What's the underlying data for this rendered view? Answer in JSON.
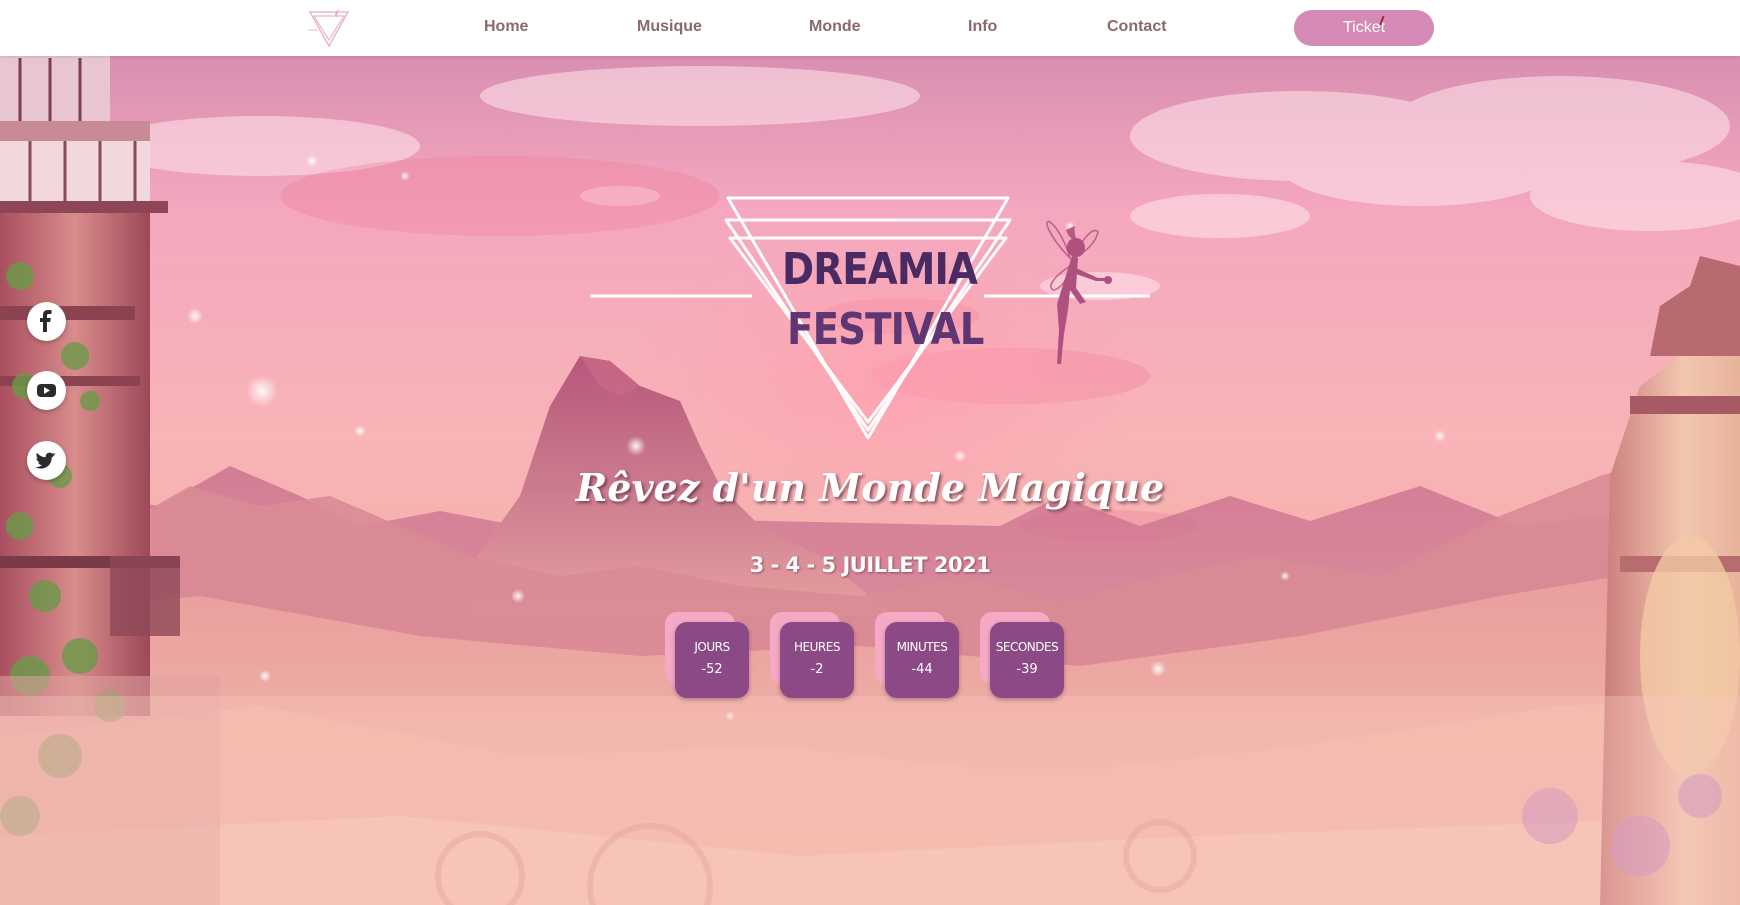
{
  "nav": {
    "links": [
      "Home",
      "Musique",
      "Monde",
      "Info",
      "Contact"
    ],
    "ticket_label": "Ticket"
  },
  "social": {
    "icons": [
      "facebook-icon",
      "youtube-icon",
      "twitter-icon"
    ]
  },
  "hero": {
    "logo_line1": "DREAMIA",
    "logo_line2": "FESTIVAL",
    "tagline": "Rêvez d'un Monde Magique",
    "dates": "3 - 4 - 5 JUILLET 2021"
  },
  "countdown": [
    {
      "label": "JOURS",
      "value": "-52"
    },
    {
      "label": "HEURES",
      "value": "-2"
    },
    {
      "label": "MINUTES",
      "value": "-44"
    },
    {
      "label": "SECONDES",
      "value": "-39"
    }
  ],
  "colors": {
    "nav_text": "#8a6a6a",
    "ticket_bg": "#d58ab5",
    "countdown_front": "#8b4a86",
    "countdown_back": "#f5a9c4",
    "logo_text": "#4a2a63"
  }
}
